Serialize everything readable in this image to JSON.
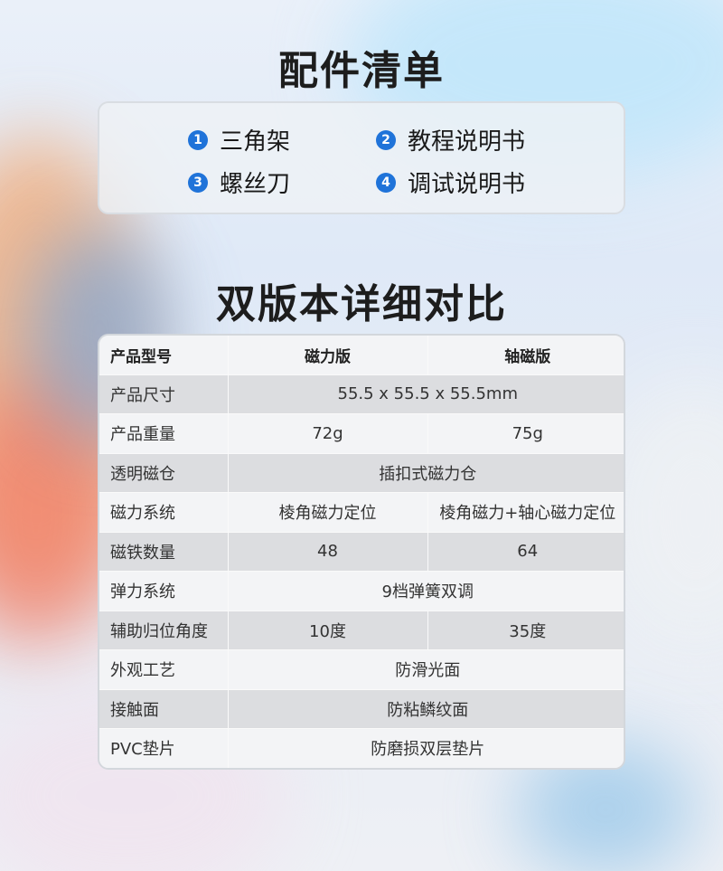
{
  "accessories": {
    "title": "配件清单",
    "items": [
      {
        "num": "1",
        "label": "三角架"
      },
      {
        "num": "2",
        "label": "教程说明书"
      },
      {
        "num": "3",
        "label": "螺丝刀"
      },
      {
        "num": "4",
        "label": "调试说明书"
      }
    ]
  },
  "comparison": {
    "title": "双版本详细对比",
    "headers": [
      "产品型号",
      "磁力版",
      "轴磁版"
    ],
    "rows": [
      {
        "label": "产品尺寸",
        "merged": "55.5 x 55.5 x 55.5mm"
      },
      {
        "label": "产品重量",
        "v1": "72g",
        "v2": "75g"
      },
      {
        "label": "透明磁仓",
        "merged": "插扣式磁力仓"
      },
      {
        "label": "磁力系统",
        "v1": "棱角磁力定位",
        "v2": "棱角磁力+轴心磁力定位"
      },
      {
        "label": "磁铁数量",
        "v1": "48",
        "v2": "64"
      },
      {
        "label": "弹力系统",
        "merged": "9档弹簧双调"
      },
      {
        "label": "辅助归位角度",
        "v1": "10度",
        "v2": "35度"
      },
      {
        "label": "外观工艺",
        "merged": "防滑光面"
      },
      {
        "label": "接触面",
        "merged": "防粘鳞纹面"
      },
      {
        "label": "PVC垫片",
        "merged": "防磨损双层垫片"
      }
    ]
  },
  "colors": {
    "number_badge": "#1f73d9",
    "row_dark": "#dcdde0",
    "row_light": "#f3f4f6"
  }
}
